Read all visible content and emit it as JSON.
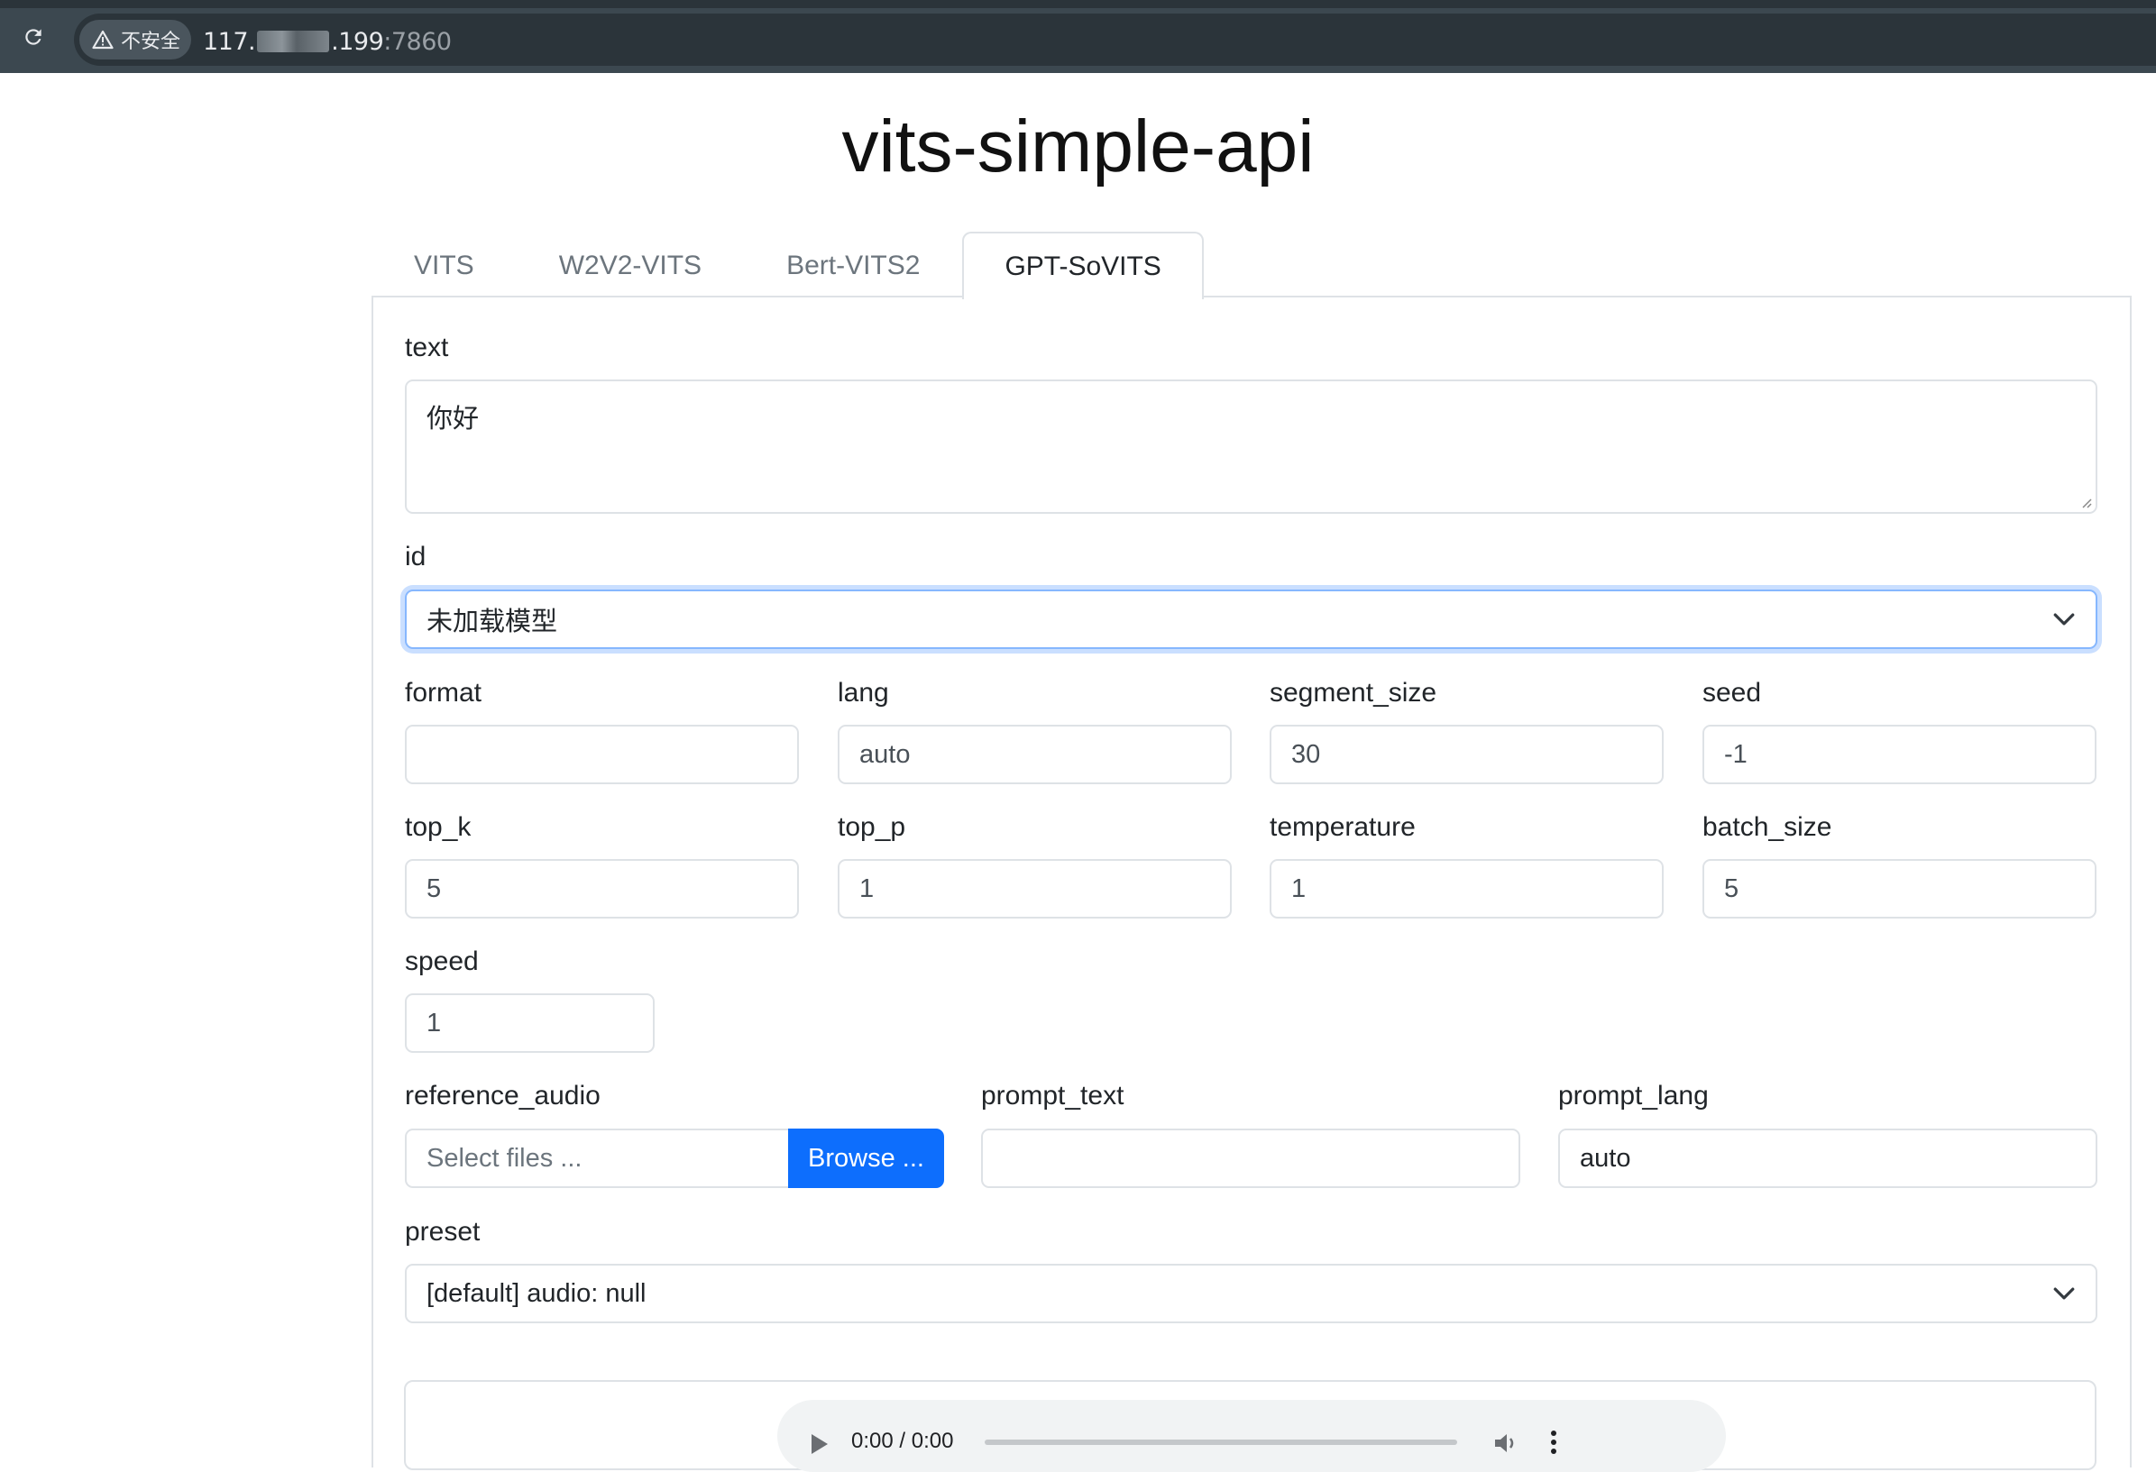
{
  "browser": {
    "security_label": "不安全",
    "url_prefix": "117.",
    "url_suffix": ".199",
    "url_port": ":7860"
  },
  "page": {
    "title": "vits-simple-api"
  },
  "tabs": [
    {
      "label": "VITS",
      "active": false
    },
    {
      "label": "W2V2-VITS",
      "active": false
    },
    {
      "label": "Bert-VITS2",
      "active": false
    },
    {
      "label": "GPT-SoVITS",
      "active": true
    }
  ],
  "form": {
    "text": {
      "label": "text",
      "value": "你好"
    },
    "id": {
      "label": "id",
      "value": "未加载模型"
    },
    "format": {
      "label": "format",
      "value": ""
    },
    "lang": {
      "label": "lang",
      "value": "auto"
    },
    "segment_size": {
      "label": "segment_size",
      "value": "30"
    },
    "seed": {
      "label": "seed",
      "value": "-1"
    },
    "top_k": {
      "label": "top_k",
      "value": "5"
    },
    "top_p": {
      "label": "top_p",
      "value": "1"
    },
    "temperature": {
      "label": "temperature",
      "value": "1"
    },
    "batch_size": {
      "label": "batch_size",
      "value": "5"
    },
    "speed": {
      "label": "speed",
      "value": "1"
    },
    "reference_audio": {
      "label": "reference_audio",
      "placeholder": "Select files ...",
      "button": "Browse ..."
    },
    "prompt_text": {
      "label": "prompt_text",
      "value": ""
    },
    "prompt_lang": {
      "label": "prompt_lang",
      "value": "auto"
    },
    "preset": {
      "label": "preset",
      "value": "[default] audio: null"
    }
  },
  "audio": {
    "time": "0:00 / 0:00"
  },
  "colors": {
    "primary": "#0d6efd",
    "focus_ring": "#86b7fe",
    "border": "#dee2e6"
  }
}
